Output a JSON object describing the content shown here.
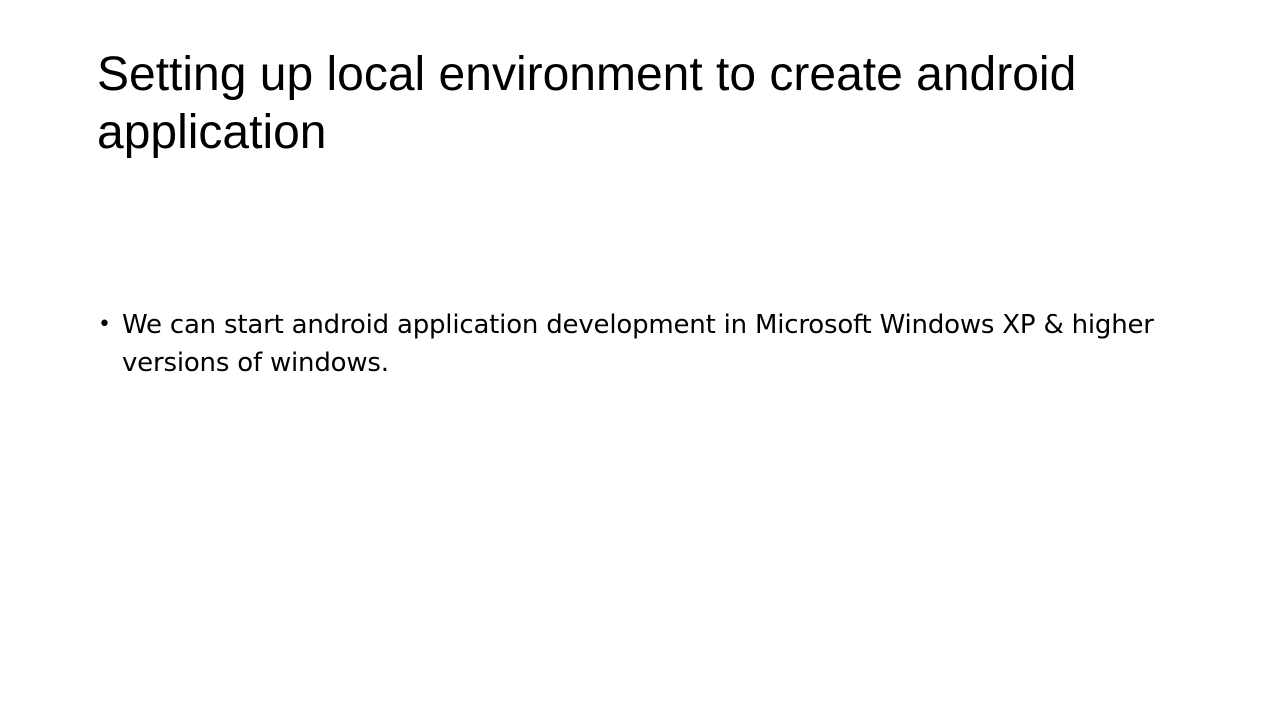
{
  "slide": {
    "title": "Setting up local environment to create android application",
    "bullets": [
      {
        "glyph": "•",
        "text": "We can start android application development in Microsoft Windows XP & higher versions of windows."
      }
    ]
  }
}
